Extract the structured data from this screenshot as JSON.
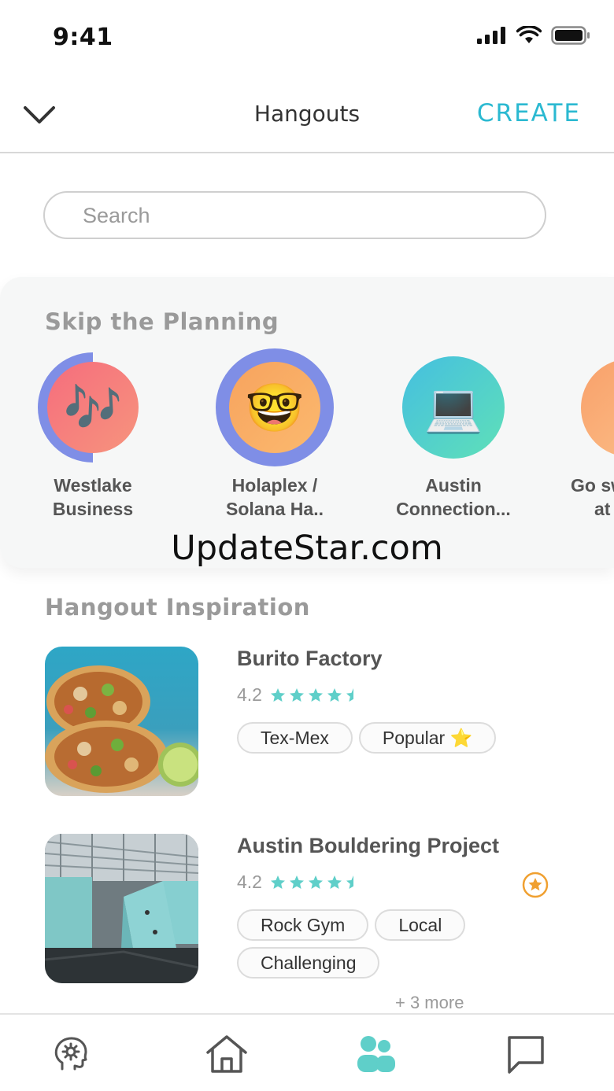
{
  "status_bar": {
    "time": "9:41"
  },
  "header": {
    "title": "Hangouts",
    "create_label": "CREATE"
  },
  "search": {
    "placeholder": "Search"
  },
  "skip_section": {
    "title": "Skip the Planning",
    "items": [
      {
        "label_line1": "Westlake",
        "label_line2": "Business",
        "emoji": "🎶",
        "icon": "music-notes-icon",
        "progress": 0.5
      },
      {
        "label_line1": "Holaplex /",
        "label_line2": "Solana Ha..",
        "emoji": "🤓",
        "icon": "nerd-face-icon",
        "progress": 1.0
      },
      {
        "label_line1": "Austin",
        "label_line2": "Connection...",
        "emoji": "💻",
        "icon": "laptop-icon",
        "progress": 0
      },
      {
        "label_line1": "Go sw",
        "label_line2": "at",
        "emoji": "",
        "icon": "partial-item-icon",
        "progress": 0
      }
    ]
  },
  "watermark": "UpdateStar.com",
  "inspiration": {
    "title": "Hangout Inspiration",
    "cards": [
      {
        "name": "Burito Factory",
        "rating": "4.2",
        "stars": 4.5,
        "tags": [
          "Tex-Mex",
          "Popular ⭐"
        ],
        "more": "",
        "favorite": false
      },
      {
        "name": "Austin Bouldering Project",
        "rating": "4.2",
        "stars": 4.5,
        "tags": [
          "Rock Gym",
          "Local",
          "Challenging"
        ],
        "more": "+ 3 more",
        "favorite": true
      }
    ]
  },
  "colors": {
    "accent": "#2bb9d1",
    "star": "#5fcfc9",
    "ring": "#7f8ee6",
    "favorite": "#f0a030"
  }
}
